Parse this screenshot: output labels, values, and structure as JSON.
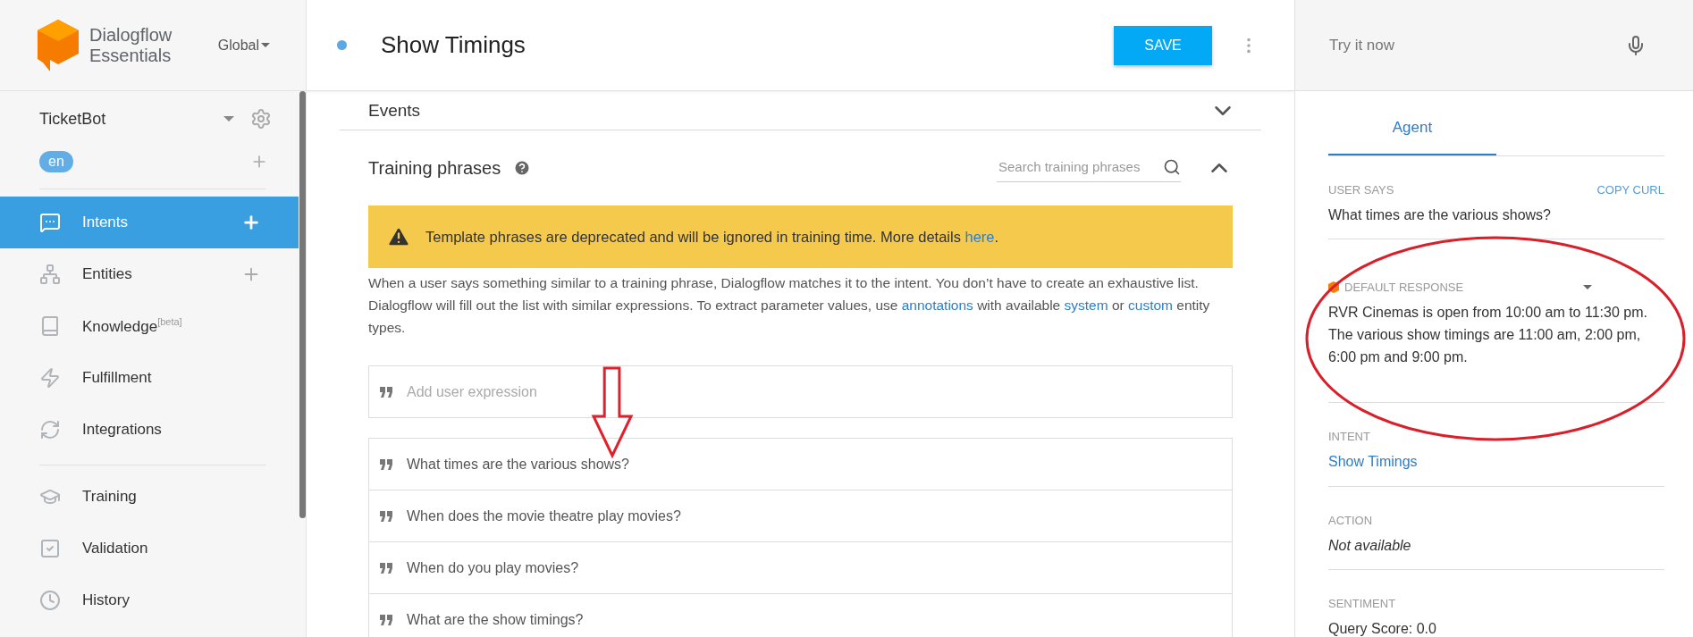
{
  "sidebar": {
    "logo_lines": [
      "Dialogflow",
      "Essentials"
    ],
    "region": "Global",
    "agent": "TicketBot",
    "language": "en",
    "nav_groups": [
      [
        {
          "label": "Intents",
          "selected": true,
          "add": true
        },
        {
          "label": "Entities",
          "selected": false,
          "add": true
        },
        {
          "label": "Knowledge$^{[beta]}$",
          "selected": false,
          "add": false
        },
        {
          "label": "Fulfillment",
          "selected": false,
          "add": false
        },
        {
          "label": "Integrations",
          "selected": false,
          "add": false
        }
      ],
      [
        {
          "label": "Training",
          "selected": false,
          "add": false
        },
        {
          "label": "Validation",
          "selected": false,
          "add": false
        },
        {
          "label": "History",
          "selected": false,
          "add": false
        }
      ]
    ]
  },
  "editor": {
    "title": "Show Timings",
    "save": "SAVE",
    "events": {
      "title": "Events",
      "expanded": false
    },
    "training": {
      "title": "Training phrases",
      "expanded": true,
      "search_placeholder": "Search training phrases",
      "warning": [
        {
          "text": "Template phrases are deprecated and will be ignored in training time. More details "
        },
        {
          "link": "here"
        },
        {
          "text": "."
        }
      ],
      "description": [
        {
          "text": "When a user says something similar to a training phrase, Dialogflow matches it to the intent. You don’t have to create an exhaustive list. Dialogflow will fill out the list with similar expressions. To extract parameter values, use "
        },
        {
          "link": "annotations"
        },
        {
          "text": " with available "
        },
        {
          "link": "system"
        },
        {
          "text": " or "
        },
        {
          "link": "custom"
        },
        {
          "text": " entity types."
        }
      ],
      "add_placeholder": "Add user expression",
      "phrases": [
        "What times are the various shows?",
        "When does the movie theatre play movies?",
        "When do you play movies?",
        "What are the show timings?"
      ]
    }
  },
  "test_console": {
    "placeholder": "Try it now",
    "tabs": [
      {
        "label": "Agent",
        "selected": true
      }
    ],
    "user_says_label": "USER SAYS",
    "copy_curl": "COPY CURL",
    "user_says": "What times are the various shows?",
    "response_label": "DEFAULT RESPONSE",
    "response": "RVR Cinemas is open from 10:00 am to 11:30 pm. The various show timings are 11:00 am, 2:00 pm, 6:00 pm and 9:00 pm.",
    "intent_label": "INTENT",
    "intent": "Show Timings",
    "action_label": "ACTION",
    "action": "Not available",
    "sentiment_label": "SENTIMENT",
    "sentiment": "Query Score: 0.0"
  },
  "annotations": [
    {
      "kind": "arrow"
    },
    {
      "kind": "ellipse"
    }
  ]
}
